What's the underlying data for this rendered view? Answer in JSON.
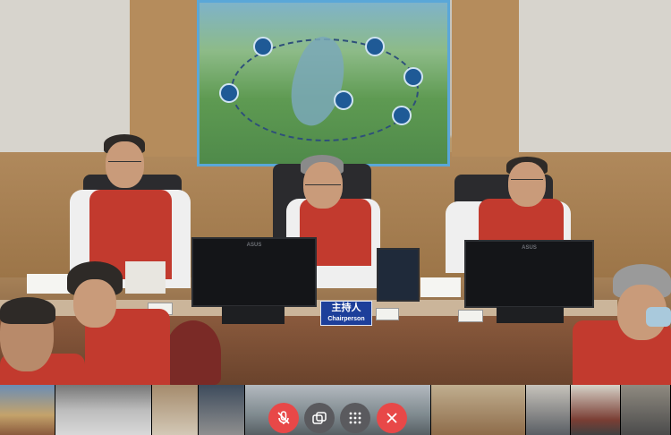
{
  "window": {
    "title": "",
    "theme": "video-conference"
  },
  "scene": {
    "poster_slogan": "",
    "chair_sign": {
      "zh": "主持人",
      "en": "Chairperson"
    },
    "monitor_brand": "ASUS"
  },
  "controls": [
    {
      "name": "mute-microphone",
      "icon": "microphone-off-icon",
      "color": "#e84848"
    },
    {
      "name": "switch-camera",
      "icon": "camera-switch-icon",
      "color": "#5a5a5e"
    },
    {
      "name": "more-options",
      "icon": "grid-dots-icon",
      "color": "#5a5a5e"
    },
    {
      "name": "leave-meeting",
      "icon": "close-icon",
      "color": "#e84848"
    }
  ],
  "participants_strip": {
    "tile_count": 9
  },
  "colors": {
    "vest": "#c23a2e",
    "sign": "#1d3f9a",
    "end_call": "#e84848"
  }
}
